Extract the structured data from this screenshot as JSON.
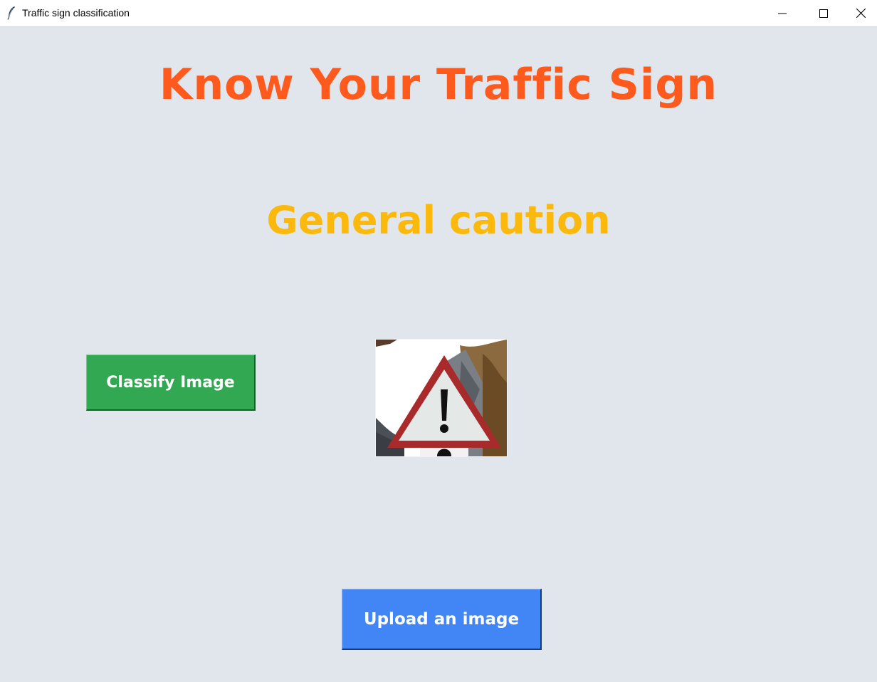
{
  "window": {
    "title": "Traffic sign classification",
    "app_icon": "feather-icon",
    "controls": {
      "minimize_icon": "minimize-icon",
      "maximize_icon": "maximize-icon",
      "close_icon": "close-icon"
    }
  },
  "main": {
    "heading": "Know Your Traffic Sign",
    "prediction": "General caution",
    "classify_button": "Classify Image",
    "upload_button": "Upload an image",
    "image_content": "warning-triangle-sign-photo"
  },
  "colors": {
    "background": "#e1e6ec",
    "heading": "#fe5a1d",
    "prediction": "#fbb80d",
    "classify_button": "#33a852",
    "upload_button": "#4285f4"
  }
}
